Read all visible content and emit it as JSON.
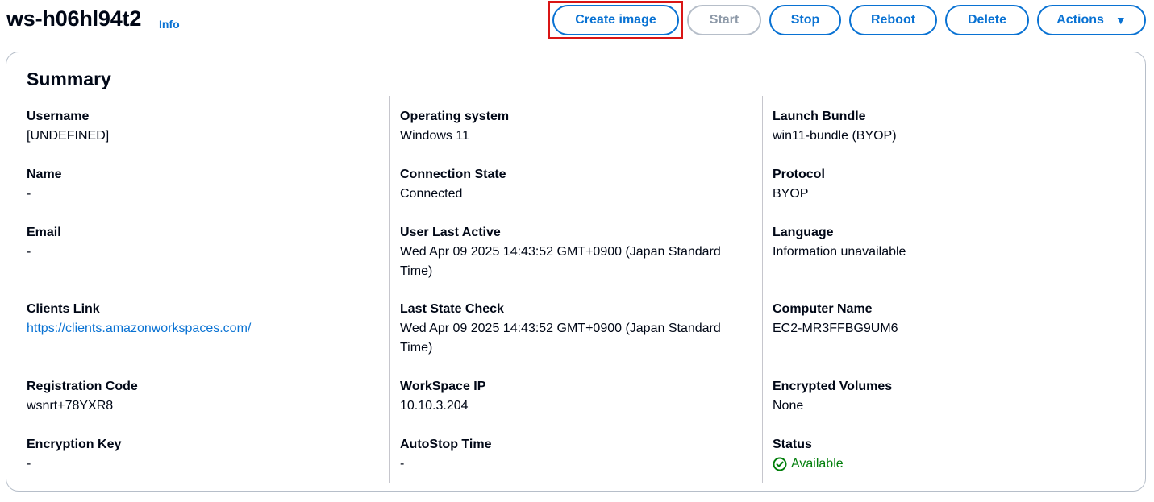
{
  "header": {
    "title": "ws-h06hl94t2",
    "info_label": "Info"
  },
  "actions": {
    "create_image": "Create image",
    "start": "Start",
    "stop": "Stop",
    "reboot": "Reboot",
    "delete": "Delete",
    "actions": "Actions"
  },
  "summary": {
    "title": "Summary",
    "col1": [
      {
        "label": "Username",
        "value": "[UNDEFINED]"
      },
      {
        "label": "Name",
        "value": "-"
      },
      {
        "label": "Email",
        "value": "-"
      },
      {
        "label": "Clients Link",
        "value": "https://clients.amazonworkspaces.com/"
      },
      {
        "label": "Registration Code",
        "value": "wsnrt+78YXR8"
      },
      {
        "label": "Encryption Key",
        "value": "-"
      }
    ],
    "col2": [
      {
        "label": "Operating system",
        "value": "Windows 11"
      },
      {
        "label": "Connection State",
        "value": "Connected"
      },
      {
        "label": "User Last Active",
        "value": "Wed Apr 09 2025 14:43:52 GMT+0900 (Japan Standard Time)"
      },
      {
        "label": "Last State Check",
        "value": "Wed Apr 09 2025 14:43:52 GMT+0900 (Japan Standard Time)"
      },
      {
        "label": "WorkSpace IP",
        "value": "10.10.3.204"
      },
      {
        "label": "AutoStop Time",
        "value": "-"
      }
    ],
    "col3": [
      {
        "label": "Launch Bundle",
        "value": "win11-bundle (BYOP)"
      },
      {
        "label": "Protocol",
        "value": "BYOP"
      },
      {
        "label": "Language",
        "value": "Information unavailable"
      },
      {
        "label": "Computer Name",
        "value": "EC2-MR3FFBG9UM6"
      },
      {
        "label": "Encrypted Volumes",
        "value": "None"
      },
      {
        "label": "Status",
        "value": "Available"
      }
    ]
  },
  "colors": {
    "accent": "#0972d3",
    "success": "#037f0c",
    "highlight": "#d91515"
  }
}
